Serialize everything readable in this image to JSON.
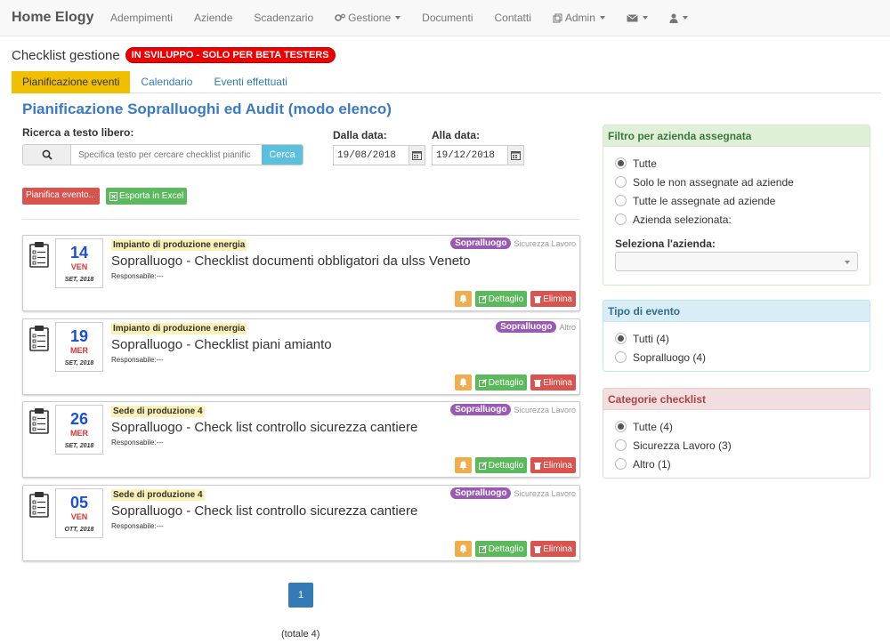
{
  "navbar": {
    "brand": "Home Elogy",
    "items": [
      "Adempimenti",
      "Aziende",
      "Scadenzario",
      "Gestione",
      "Documenti",
      "Contatti",
      "Admin"
    ]
  },
  "page": {
    "title": "Checklist gestione",
    "dev_badge": "IN SVILUPPO - SOLO PER BETA TESTERS",
    "tabs": [
      "Pianificazione eventi",
      "Calendario",
      "Eventi effettuati"
    ],
    "section_title": "Pianificazione Sopralluoghi ed Audit (modo elenco)"
  },
  "search": {
    "label": "Ricerca a testo libero:",
    "placeholder": "Specifica testo per cercare checklist pianific",
    "button": "Cerca"
  },
  "dates": {
    "from_label": "Dalla data:",
    "from_value": "19/08/2018",
    "to_label": "Alla data:",
    "to_value": "19/12/2018"
  },
  "actions": {
    "plan": "Pianifica evento...",
    "export": "Esporta in Excel"
  },
  "events": [
    {
      "day": "14",
      "dow": "VEN",
      "month": "SET, 2018",
      "site": "Impianto di produzione energia",
      "title": "Sopralluogo - Checklist documenti obbligatori da ulss Veneto",
      "resp": "Responsabile:---",
      "tag": "Sopralluogo",
      "category": "Sicurezza Lavoro"
    },
    {
      "day": "19",
      "dow": "MER",
      "month": "SET, 2018",
      "site": "Impianto di produzione energia",
      "title": "Sopralluogo - Checklist piani amianto",
      "resp": "Responsabile:---",
      "tag": "Sopralluogo",
      "category": "Altro"
    },
    {
      "day": "26",
      "dow": "MER",
      "month": "SET, 2018",
      "site": "Sede di produzione 4",
      "title": "Sopralluogo - Check list controllo sicurezza cantiere",
      "resp": "Responsabile:---",
      "tag": "Sopralluogo",
      "category": "Sicurezza Lavoro"
    },
    {
      "day": "05",
      "dow": "VEN",
      "month": "OTT, 2018",
      "site": "Sede di produzione 4",
      "title": "Sopralluogo - Check list controllo sicurezza cantiere",
      "resp": "Responsabile:---",
      "tag": "Sopralluogo",
      "category": "Sicurezza Lavoro"
    }
  ],
  "event_buttons": {
    "detail": "Dettaglio",
    "delete": "Elimina"
  },
  "pagination": {
    "current": "1",
    "total": "(totale 4)"
  },
  "filters": {
    "company": {
      "title": "Filtro per azienda assegnata",
      "options": [
        "Tutte",
        "Solo le non assegnate ad aziende",
        "Tutte le assegnate ad aziende",
        "Azienda selezionata:"
      ],
      "selected": 0,
      "select_label": "Seleziona l'azienda:"
    },
    "event_type": {
      "title": "Tipo di evento",
      "options": [
        "Tutti (4)",
        "Sopralluogo (4)"
      ],
      "selected": 0
    },
    "categories": {
      "title": "Categorie checklist",
      "options": [
        "Tutte (4)",
        "Sicurezza Lavoro (3)",
        "Altro (1)"
      ],
      "selected": 0
    }
  },
  "colors": {
    "brand_blue": "#3a7ac8",
    "active_tab": "#f0c000",
    "tag_purple": "#9b59b6",
    "danger": "#d9534f",
    "success": "#5cb85c",
    "warning": "#f0ad4e",
    "info": "#5bc0de"
  }
}
